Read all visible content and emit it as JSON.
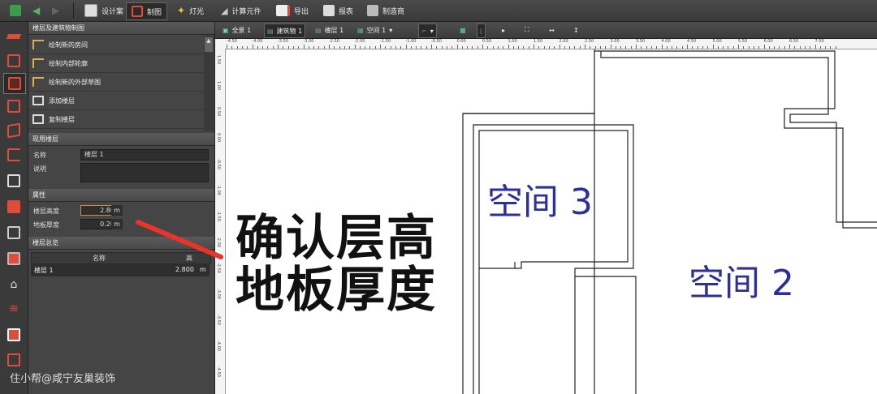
{
  "toolbar": {
    "design": "设计案",
    "draw": "制图",
    "light": "灯光",
    "calc": "计算元件",
    "export": "导出",
    "report": "报表",
    "maker": "制造商"
  },
  "canvas_toolbar": {
    "full": "全景 1",
    "building": "建筑物 1",
    "floor": "楼层 1",
    "space": "空间 1"
  },
  "panel": {
    "title": "楼层及建筑物制图",
    "actions": [
      "绘制新的房间",
      "绘制内部轮廓",
      "绘制新的外部草图",
      "添加楼层",
      "复制楼层"
    ],
    "current_floor": {
      "header": "现用楼层",
      "name_label": "名称",
      "name_value": "楼层 1",
      "desc_label": "说明"
    },
    "properties": {
      "header": "属性",
      "height_label": "楼层高度",
      "height_value": "2.800",
      "thickness_label": "地板厚度",
      "thickness_value": "0.200",
      "unit": "m"
    },
    "overview": {
      "header": "楼层总览",
      "col_name": "名称",
      "col_height": "高",
      "row_name": "楼层 1",
      "row_height": "2.800",
      "row_unit": "m"
    }
  },
  "ruler_top": [
    "-4.50",
    "-4.00",
    "-3.50",
    "-3.00",
    "-2.50",
    "-2.00",
    "-1.50",
    "-1.00",
    "-0.50",
    "0.00",
    "0.50",
    "1.00",
    "1.50",
    "2.00",
    "2.50",
    "3.00",
    "3.50",
    "4.00",
    "4.50",
    "5.00",
    "5.50",
    "6.00",
    "6.50",
    "7.00"
  ],
  "ruler_left": [
    "1.50",
    "1.00",
    "0.50",
    "0.00",
    "-0.50",
    "-1.00",
    "-1.50",
    "-2.00",
    "-2.50",
    "-3.00",
    "-3.50",
    "-4.00",
    "-4.50"
  ],
  "rooms": {
    "room3": "空间 3",
    "room2": "空间 2"
  },
  "overlay": {
    "line1": "确认层高",
    "line2": "地板厚度"
  },
  "watermark": "住小帮@咸宁友巢装饰",
  "colors": {
    "accent_red": "#e14b3a",
    "room_label": "#2f2f9a"
  }
}
